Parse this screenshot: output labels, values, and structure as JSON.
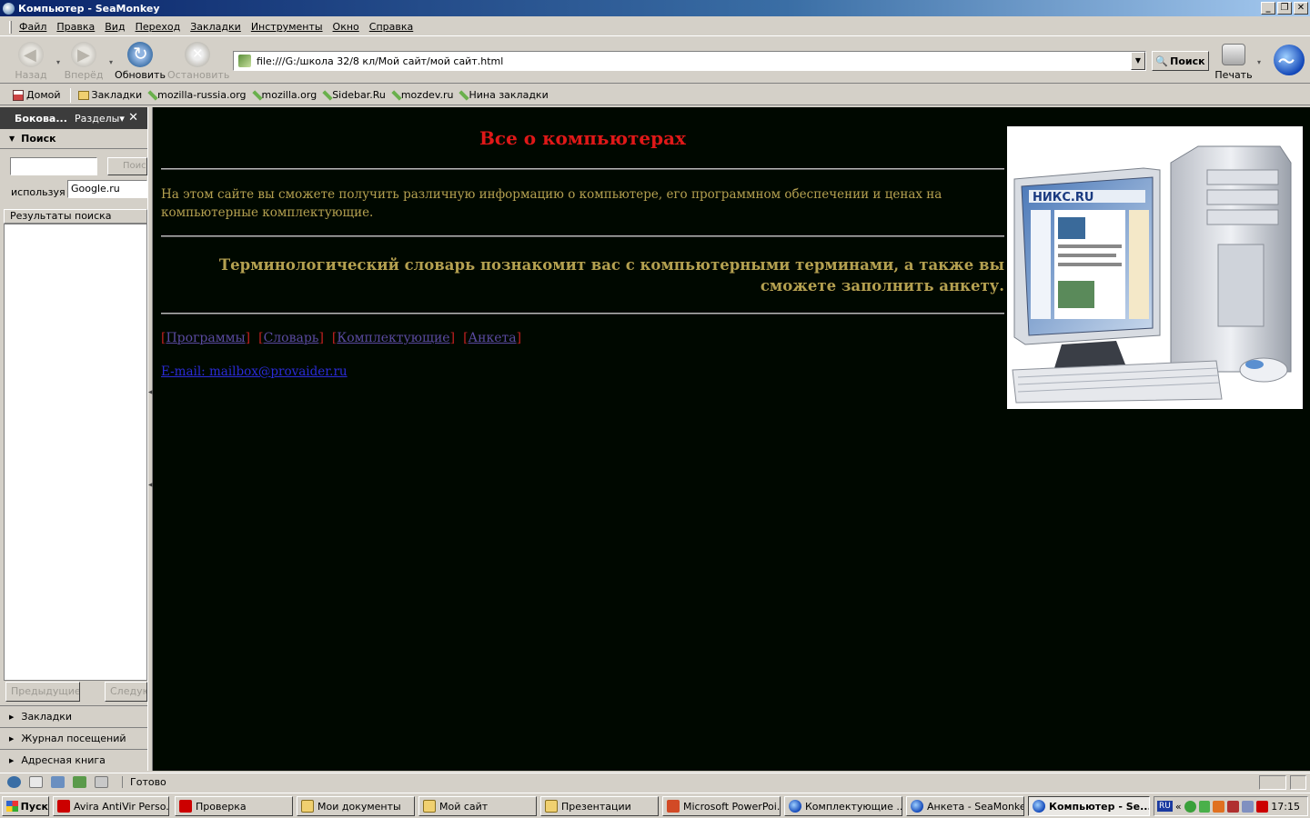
{
  "window": {
    "title": "Компьютер - SeaMonkey",
    "controls": [
      "_",
      "❐",
      "✕"
    ]
  },
  "menu": [
    "Файл",
    "Правка",
    "Вид",
    "Переход",
    "Закладки",
    "Инструменты",
    "Окно",
    "Справка"
  ],
  "toolbar": {
    "back": "Назад",
    "forward": "Вперёд",
    "reload": "Обновить",
    "stop": "Остановить",
    "url": "file:///G:/школа 32/8 кл/Мой сайт/мой сайт.html",
    "search": "Поиск",
    "print": "Печать"
  },
  "bookmarks": [
    "Домой",
    "Закладки",
    "mozilla-russia.org",
    "mozilla.org",
    "Sidebar.Ru",
    "mozdev.ru",
    "Нина закладки"
  ],
  "sidebar": {
    "title": "Бокова...",
    "sections_label": "Разделы",
    "close": "✕",
    "search_panel": "Поиск",
    "search_button": "Поиск",
    "using_label": "используя",
    "engine": "Google.ru",
    "results_header": "Результаты поиска",
    "prev": "Предыдущие",
    "next": "Следующие",
    "sections": [
      "Закладки",
      "Журнал посещений",
      "Адресная книга"
    ]
  },
  "page": {
    "title": "Все о компьютерах",
    "intro": "На этом сайте вы сможете получить различную информацию о компьютере, его программном обеспечении и ценах на компьютерные комплектующие.",
    "dictionary": "Терминологический словарь познакомит вас с компьютерными терминами, а также вы сможете заполнить анкету.",
    "links": [
      "Программы",
      "Словарь",
      "Комплектующие",
      "Анкета"
    ],
    "email": "E-mail: mailbox@provaider.ru",
    "image_logo": "НИКС.RU",
    "colors": {
      "background": "#000800",
      "title": "#e01818",
      "text": "#b4a050",
      "link": "#5a4aa0",
      "email": "#2b2bd8"
    }
  },
  "status": {
    "text": "Готово"
  },
  "taskbar": {
    "start": "Пуск",
    "tasks": [
      {
        "label": "Avira AntiVir Perso...",
        "icon": "avira-icon"
      },
      {
        "label": "Проверка",
        "icon": "avira-icon"
      },
      {
        "label": "Мои документы",
        "icon": "folder-icon"
      },
      {
        "label": "Мой сайт",
        "icon": "folder-icon"
      },
      {
        "label": "Презентации",
        "icon": "folder-icon"
      },
      {
        "label": "Microsoft PowerPoi...",
        "icon": "powerpoint-icon"
      },
      {
        "label": "Комплектующие ...",
        "icon": "seamonkey-icon"
      },
      {
        "label": "Анкета - SeaMonkey",
        "icon": "seamonkey-icon"
      },
      {
        "label": "Компьютер - Se...",
        "icon": "seamonkey-icon",
        "active": true
      }
    ],
    "lang": "RU",
    "chevron": "«",
    "clock": "17:15"
  }
}
